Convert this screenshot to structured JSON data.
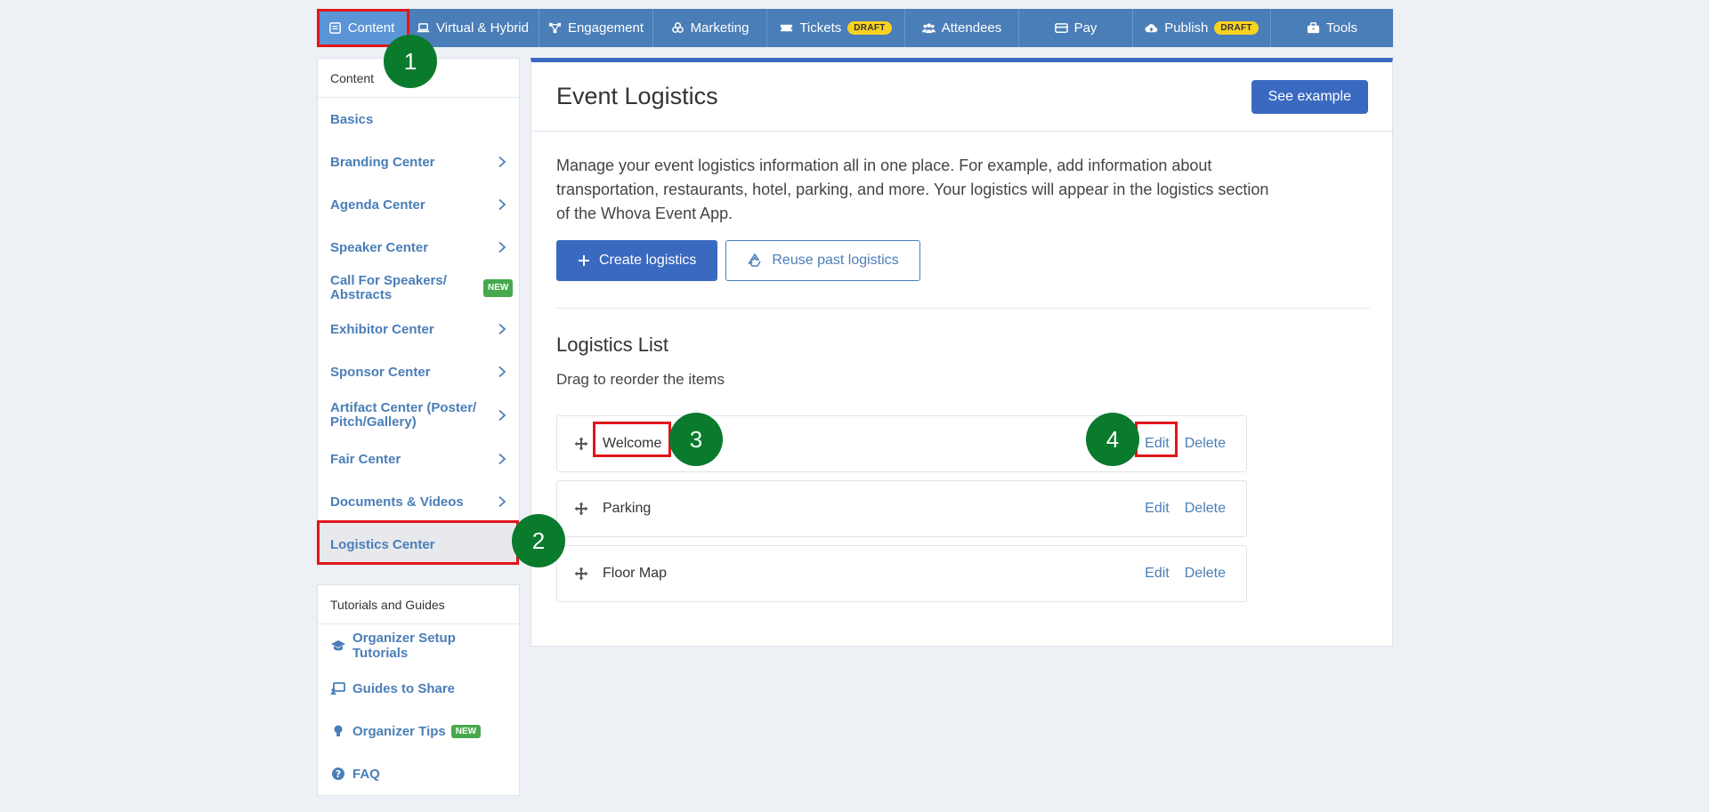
{
  "nav": {
    "items": [
      {
        "label": "Content",
        "icon": "document-icon"
      },
      {
        "label": "Virtual & Hybrid",
        "icon": "laptop-icon"
      },
      {
        "label": "Engagement",
        "icon": "network-icon"
      },
      {
        "label": "Marketing",
        "icon": "users-group-icon"
      },
      {
        "label": "Tickets",
        "icon": "ticket-icon",
        "badge": "DRAFT"
      },
      {
        "label": "Attendees",
        "icon": "attendees-icon"
      },
      {
        "label": "Pay",
        "icon": "credit-card-icon"
      },
      {
        "label": "Publish",
        "icon": "cloud-upload-icon",
        "badge": "DRAFT"
      },
      {
        "label": "Tools",
        "icon": "toolbox-icon"
      }
    ]
  },
  "markers": [
    "1",
    "2",
    "3",
    "4"
  ],
  "sidebar": {
    "header": "Content",
    "items": [
      {
        "label": "Basics"
      },
      {
        "label": "Branding Center"
      },
      {
        "label": "Agenda Center"
      },
      {
        "label": "Speaker Center"
      },
      {
        "label": "Call For Speakers/ Abstracts",
        "badge": "NEW"
      },
      {
        "label": "Exhibitor Center"
      },
      {
        "label": "Sponsor Center"
      },
      {
        "label": "Artifact Center (Poster/ Pitch/Gallery)"
      },
      {
        "label": "Fair Center"
      },
      {
        "label": "Documents & Videos"
      },
      {
        "label": "Logistics Center"
      }
    ]
  },
  "tutorials": {
    "header": "Tutorials and Guides",
    "items": [
      {
        "label": "Organizer Setup Tutorials",
        "icon": "graduation-cap-icon"
      },
      {
        "label": "Guides to Share",
        "icon": "presentation-icon"
      },
      {
        "label": "Organizer Tips",
        "icon": "lightbulb-icon",
        "badge": "NEW"
      },
      {
        "label": "FAQ",
        "icon": "question-circle-icon"
      }
    ]
  },
  "main": {
    "title": "Event Logistics",
    "see_example": "See example",
    "description": "Manage your event logistics information all in one place. For example, add information about transportation, restaurants, hotel, parking, and more. Your logistics will appear in the logistics section of the Whova Event App.",
    "create_label": "Create logistics",
    "reuse_label": "Reuse past logistics",
    "list_title": "Logistics List",
    "list_subtitle": "Drag to reorder the items",
    "edit_label": "Edit",
    "delete_label": "Delete",
    "rows": [
      {
        "name": "Welcome"
      },
      {
        "name": "Parking"
      },
      {
        "name": "Floor Map"
      }
    ]
  },
  "colors": {
    "nav_bg": "#4a7eb8",
    "nav_active": "#5b95d6",
    "primary": "#3a69c0",
    "link": "#4a7eb8",
    "annotation_red": "#e0161b",
    "marker_green": "#0a7a2d",
    "draft_badge": "#f7d21e",
    "new_badge": "#47a84d"
  }
}
